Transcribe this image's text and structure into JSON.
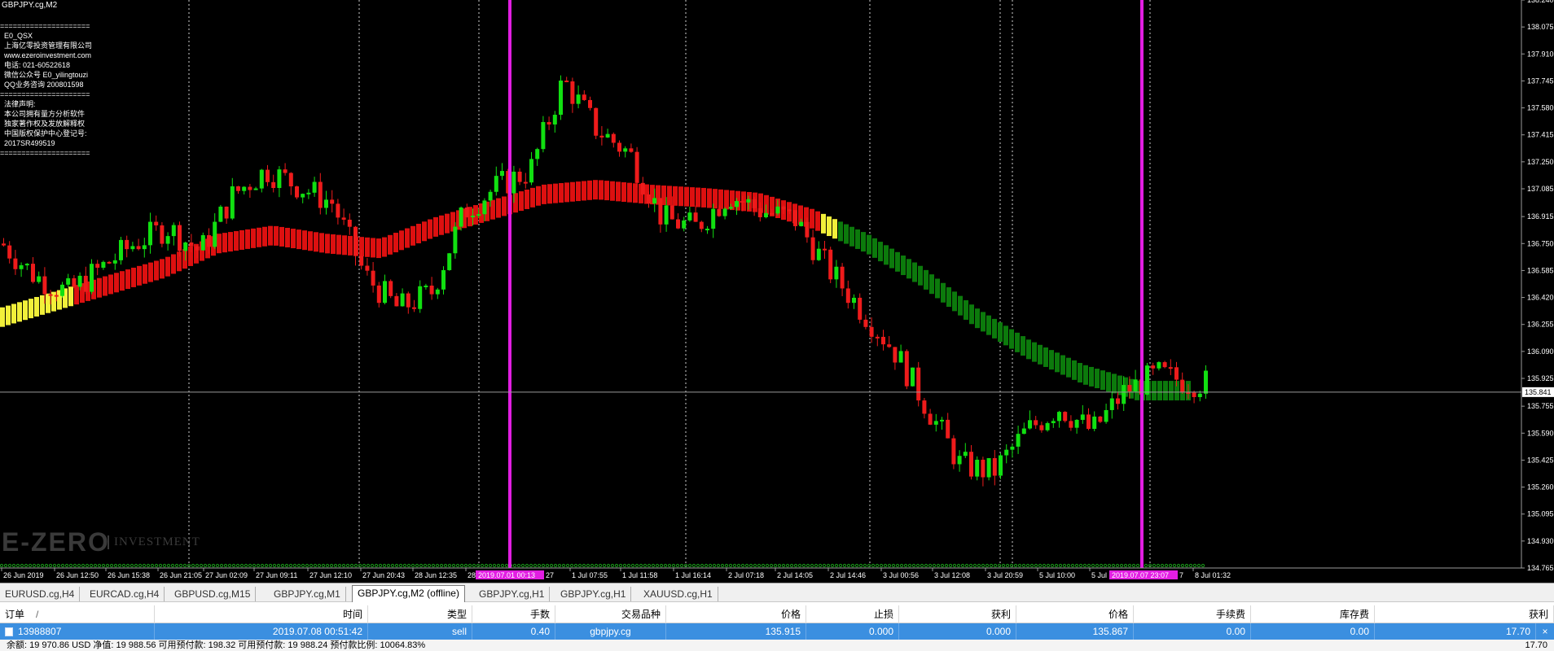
{
  "chart": {
    "title": "GBPJPY.cg,M2",
    "info_lines": [
      "=====================",
      "  E0_QSX",
      "  上海亿零投资管理有限公司",
      "  www.ezeroinvestment.com",
      "  电话: 021-60522618",
      "  微信公众号 E0_yilingtouzi",
      "  QQ业务咨询 200801598",
      "=====================",
      "  法律声明:",
      "  本公司拥有量方分析软件",
      "  独家著作权及发放解释权",
      "  中国版权保护中心登记号:",
      "  2017SR499519",
      "====================="
    ],
    "watermark": "E-ZERO",
    "watermark_sub": "INVESTMENT",
    "current_price": "135.841",
    "colors": {
      "bull": "#11e011",
      "bear": "#ee1b1b",
      "ma_red": "#dd1010",
      "ma_yellow": "#f2f03a",
      "ma_green": "#0c7a0c",
      "marker": "#e21ee2",
      "grid": "#dddddd"
    }
  },
  "price_axis": [
    "138.240",
    "138.075",
    "137.910",
    "137.745",
    "137.580",
    "137.415",
    "137.250",
    "137.085",
    "136.915",
    "136.750",
    "136.585",
    "136.420",
    "136.255",
    "136.090",
    "135.925",
    "135.755",
    "135.590",
    "135.425",
    "135.260",
    "135.095",
    "134.930",
    "134.765"
  ],
  "time_axis": [
    "26 Jun 2019",
    "26 Jun 12:50",
    "26 Jun 15:38",
    "26 Jun 21:05",
    "27 Jun 02:09",
    "27 Jun 09:11",
    "27 Jun 12:10",
    "27 Jun 20:43",
    "28 Jun 12:35",
    "28",
    "1 Jul 07:55",
    "1 Jul 11:58",
    "1 Jul 16:14",
    "2 Jul 07:18",
    "2 Jul 14:05",
    "2 Jul 14:46",
    "3 Jul 00:56",
    "3 Jul 12:08",
    "3 Jul 20:59",
    "5 Jul 10:00",
    "5 Jul",
    "8 Jul 01:32"
  ],
  "time_markers": [
    "2019.07.01 00:13",
    "2019.07.07 23:07"
  ],
  "time_marker_tails": [
    "27",
    "7"
  ],
  "chart_data": {
    "type": "candlestick",
    "symbol": "GBPJPY.cg",
    "timeframe": "M2",
    "ylim": [
      134.765,
      138.24
    ],
    "approx_close_path": [
      136.75,
      136.55,
      136.45,
      136.6,
      136.75,
      136.85,
      136.7,
      137.05,
      137.2,
      137.1,
      137.0,
      136.55,
      136.35,
      136.45,
      136.95,
      137.1,
      137.2,
      137.75,
      137.45,
      137.3,
      136.9,
      136.85,
      137.05,
      136.95,
      136.9,
      136.6,
      136.35,
      136.1,
      135.75,
      135.4,
      135.35,
      135.6,
      135.75,
      135.6,
      135.85,
      135.95,
      135.9
    ],
    "ma_path": [
      136.3,
      136.4,
      136.5,
      136.6,
      136.75,
      136.8,
      136.75,
      136.72,
      136.85,
      136.95,
      137.05,
      137.08,
      137.05,
      137.03,
      137.0,
      136.9,
      136.75,
      136.55,
      136.3,
      136.1,
      135.95,
      135.85,
      135.85
    ]
  },
  "tabs": [
    "EURUSD.cg,H4",
    "EURCAD.cg,H4",
    "GBPUSD.cg,M15",
    "GBPJPY.cg,M1",
    "GBPJPY.cg,M2 (offline)",
    "GBPJPY.cg,H1",
    "GBPJPY.cg,H1",
    "XAUUSD.cg,H1"
  ],
  "active_tab": "GBPJPY.cg,M2 (offline)",
  "terminal": {
    "headers": [
      "订单",
      "时间",
      "类型",
      "手数",
      "交易品种",
      "价格",
      "止损",
      "获利",
      "价格",
      "手续费",
      "库存费",
      "获利"
    ],
    "sort_indicator": "/",
    "row": [
      "13988807",
      "2019.07.08 00:51:42",
      "sell",
      "0.40",
      "gbpjpy.cg",
      "135.915",
      "0.000",
      "0.000",
      "135.867",
      "0.00",
      "0.00",
      "17.70"
    ],
    "balance_text": "余额: 19 970.86 USD  净值: 19 988.56  可用预付款: 198.32  可用预付款: 19 988.24  预付款比例: 10064.83%",
    "balance_profit": "17.70",
    "close_icon": "×"
  }
}
